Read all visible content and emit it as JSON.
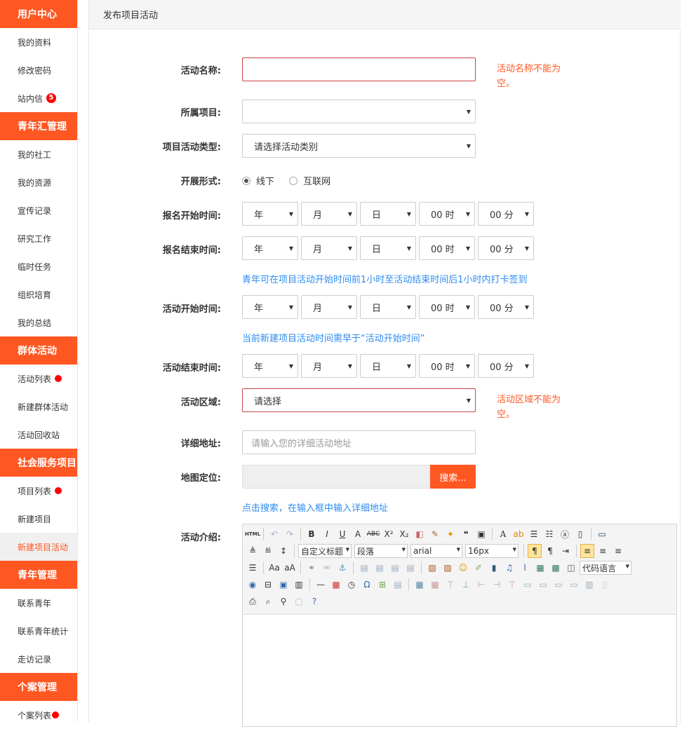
{
  "sidebar": {
    "sections": [
      {
        "title": "用户中心",
        "items": [
          {
            "label": "我的资料"
          },
          {
            "label": "修改密码"
          },
          {
            "label": "站内信",
            "badge": "5"
          }
        ]
      },
      {
        "title": "青年汇管理",
        "items": [
          {
            "label": "我的社工"
          },
          {
            "label": "我的资源"
          },
          {
            "label": "宣传记录"
          },
          {
            "label": "研究工作"
          },
          {
            "label": "临时任务"
          },
          {
            "label": "组织培育"
          },
          {
            "label": "我的总结"
          }
        ]
      },
      {
        "title": "群体活动",
        "items": [
          {
            "label": "活动列表"
          },
          {
            "label": "新建群体活动"
          },
          {
            "label": "活动回收站"
          }
        ]
      },
      {
        "title": "社会服务项目",
        "items": [
          {
            "label": "项目列表"
          },
          {
            "label": "新建项目"
          },
          {
            "label": "新建项目活动"
          }
        ]
      },
      {
        "title": "青年管理",
        "items": [
          {
            "label": "联系青年"
          },
          {
            "label": "联系青年统计"
          },
          {
            "label": "走访记录"
          }
        ]
      },
      {
        "title": "个案管理",
        "items": [
          {
            "label": "个案列表"
          }
        ]
      }
    ]
  },
  "page": {
    "title": "发布项目活动"
  },
  "form": {
    "name": {
      "label": "活动名称:",
      "value": "",
      "error": "活动名称不能为空。"
    },
    "project": {
      "label": "所属项目:",
      "value": ""
    },
    "type": {
      "label": "项目活动类型:",
      "value": "请选择活动类别"
    },
    "mode": {
      "label": "开展形式:",
      "options": [
        "线下",
        "互联网"
      ],
      "selected": "线下"
    },
    "dt_defaults": {
      "year": "年",
      "month": "月",
      "day": "日",
      "hour": "00 时",
      "minute": "00 分"
    },
    "signup_start": {
      "label": "报名开始时间:"
    },
    "signup_end": {
      "label": "报名结束时间:"
    },
    "checkin_hint": "青年可在项目活动开始时间前1小时至活动结束时间后1小时内打卡签到",
    "activity_start": {
      "label": "活动开始时间:"
    },
    "start_hint": "当前新建项目活动时间需早于“活动开始时间”",
    "activity_end": {
      "label": "活动结束时间:"
    },
    "region": {
      "label": "活动区域:",
      "value": "请选择",
      "error": "活动区域不能为空。"
    },
    "address": {
      "label": "详细地址:",
      "placeholder": "请输入您的详细活动地址"
    },
    "map": {
      "label": "地图定位:",
      "button": "搜索...",
      "hint": "点击搜索，在输入框中输入详细地址"
    },
    "intro": {
      "label": "活动介绍:"
    }
  },
  "editor": {
    "html_label": "HTML",
    "custom_title": "自定义标题",
    "paragraph": "段落",
    "font": "arial",
    "size": "16px",
    "code_lang": "代码语言"
  },
  "colors": {
    "accent": "#ff5722",
    "hint": "#2d8cf0",
    "error_border": "#cc4444"
  }
}
